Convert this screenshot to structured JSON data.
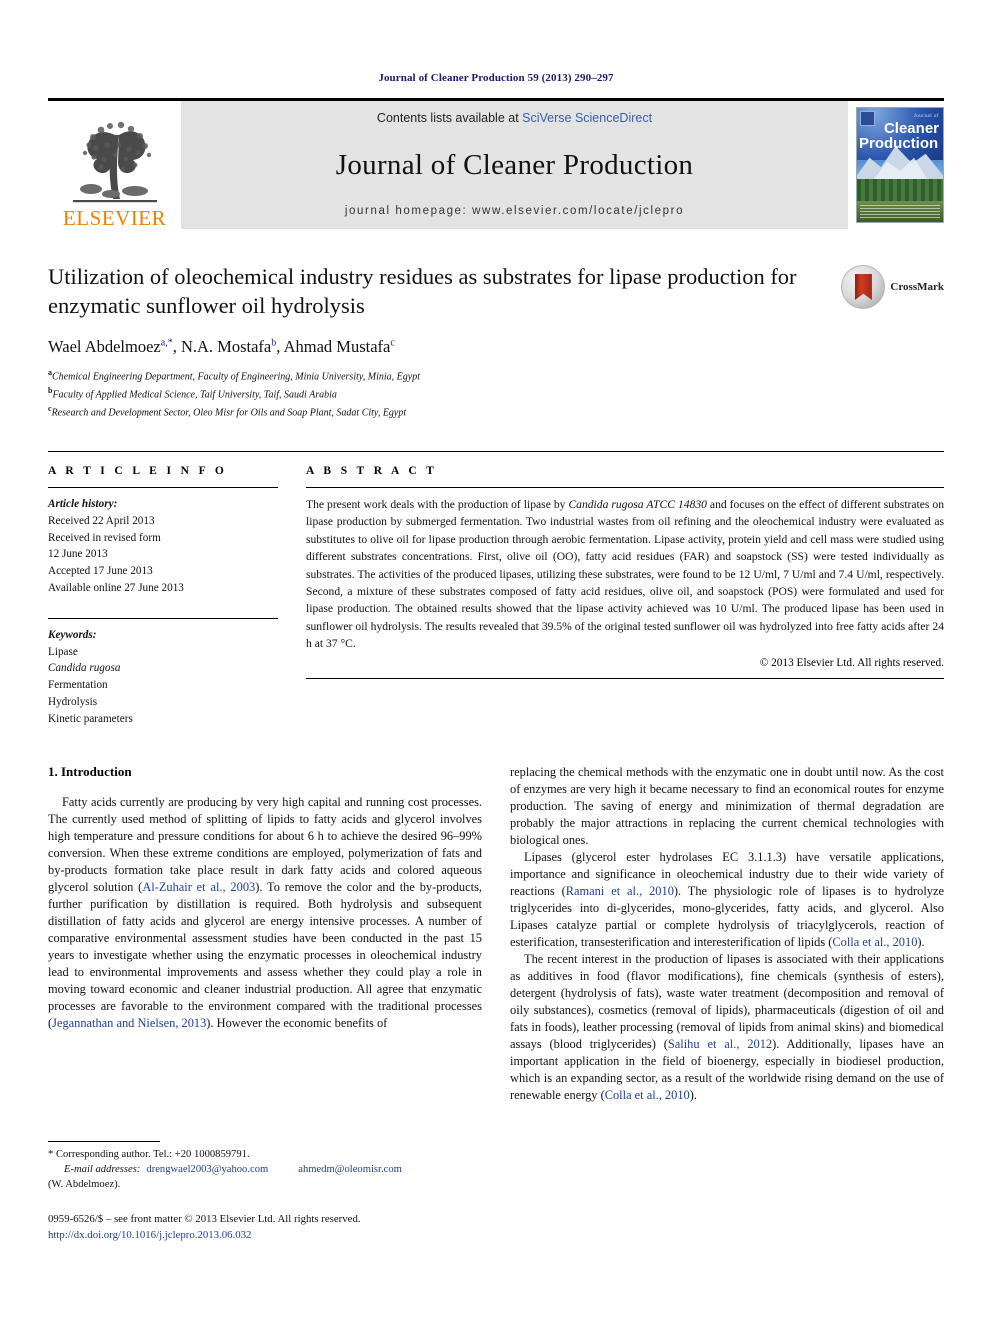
{
  "running_head": "Journal of Cleaner Production 59 (2013) 290–297",
  "masthead": {
    "contents_prefix": "Contents lists available at ",
    "sciencedirect": "SciVerse ScienceDirect",
    "journal_title": "Journal of Cleaner Production",
    "homepage": "journal homepage: www.elsevier.com/locate/jclepro",
    "publisher_wordmark": "ELSEVIER",
    "cover": {
      "journal_of": "Journal of",
      "line1": "Cleaner",
      "line2": "Production"
    }
  },
  "article": {
    "title": "Utilization of oleochemical industry residues as substrates for lipase production for enzymatic sunflower oil hydrolysis",
    "crossmark_label": "CrossMark",
    "authors_html": "Wael Abdelmoez<sup>a,*</sup>, N.A. Mostafa<sup>b</sup>, Ahmad Mustafa<sup>c</sup>",
    "affiliations": [
      {
        "marker": "a",
        "text": "Chemical Engineering Department, Faculty of Engineering, Minia University, Minia, Egypt"
      },
      {
        "marker": "b",
        "text": "Faculty of Applied Medical Science, Taif University, Taif, Saudi Arabia"
      },
      {
        "marker": "c",
        "text": "Research and Development Sector, Oleo Misr for Oils and Soap Plant, Sadat City, Egypt"
      }
    ]
  },
  "article_info": {
    "heading": "A R T I C L E   I N F O",
    "history_label": "Article history:",
    "history": [
      "Received 22 April 2013",
      "Received in revised form",
      "12 June 2013",
      "Accepted 17 June 2013",
      "Available online 27 June 2013"
    ],
    "keywords_label": "Keywords:",
    "keywords": [
      "Lipase",
      "Candida rugosa",
      "Fermentation",
      "Hydrolysis",
      "Kinetic parameters"
    ],
    "italic_keywords": [
      "Candida rugosa"
    ]
  },
  "abstract": {
    "heading": "A B S T R A C T",
    "text_html": "The present work deals with the production of lipase by <i>Candida rugosa ATCC 14830</i> and focuses on the effect of different substrates on lipase production by submerged fermentation. Two industrial wastes from oil refining and the oleochemical industry were evaluated as substitutes to olive oil for lipase production through aerobic fermentation. Lipase activity, protein yield and cell mass were studied using different substrates concentrations. First, olive oil (OO), fatty acid residues (FAR) and soapstock (SS) were tested individually as substrates. The activities of the produced lipases, utilizing these substrates, were found to be 12 U/ml, 7 U/ml and 7.4 U/ml, respectively. Second, a mixture of these substrates composed of fatty acid residues, olive oil, and soapstock (POS) were formulated and used for lipase production. The obtained results showed that the lipase activity achieved was 10 U/ml. The produced lipase has been used in sunflower oil hydrolysis. The results revealed that 39.5% of the original tested sunflower oil was hydrolyzed into free fatty acids after 24 h at 37 °C.",
    "copyright": "© 2013 Elsevier Ltd. All rights reserved."
  },
  "body": {
    "section_number_title": "1. Introduction",
    "left_paragraphs_html": [
      "Fatty acids currently are producing by very high capital and running cost processes. The currently used method of splitting of lipids to fatty acids and glycerol involves high temperature and pressure conditions for about 6 h to achieve the desired 96–99% conversion. When these extreme conditions are employed, polymerization of fats and by-products formation take place result in dark fatty acids and colored aqueous glycerol solution (<span class=\"cite\">Al-Zuhair et al., 2003</span>). To remove the color and the by-products, further purification by distillation is required. Both hydrolysis and subsequent distillation of fatty acids and glycerol are energy intensive processes. A number of comparative environmental assessment studies have been conducted in the past 15 years to investigate whether using the enzymatic processes in oleochemical industry lead to environmental improvements and assess whether they could play a role in moving toward economic and cleaner industrial production. All agree that enzymatic processes are favorable to the environment compared with the traditional processes (<span class=\"cite\">Jegannathan and Nielsen, 2013</span>). However the economic benefits of"
    ],
    "right_paragraphs_html": [
      "replacing the chemical methods with the enzymatic one in doubt until now. As the cost of enzymes are very high it became necessary to find an economical routes for enzyme production. The saving of energy and minimization of thermal degradation are probably the major attractions in replacing the current chemical technologies with biological ones.",
      "Lipases (glycerol ester hydrolases EC 3.1.1.3) have versatile applications, importance and significance in oleochemical industry due to their wide variety of reactions (<span class=\"cite\">Ramani et al., 2010</span>). The physiologic role of lipases is to hydrolyze triglycerides into di-glycerides, mono-glycerides, fatty acids, and glycerol. Also Lipases catalyze partial or complete hydrolysis of triacylglycerols, reaction of esterification, transesterification and interesterification of lipids (<span class=\"cite\">Colla et al., 2010</span>).",
      "The recent interest in the production of lipases is associated with their applications as additives in food (flavor modifications), fine chemicals (synthesis of esters), detergent (hydrolysis of fats), waste water treatment (decomposition and removal of oily substances), cosmetics (removal of lipids), pharmaceuticals (digestion of oil and fats in foods), leather processing (removal of lipids from animal skins) and biomedical assays (blood triglycerides) (<span class=\"cite\">Salihu et al., 2012</span>). Additionally, lipases have an important application in the field of bioenergy, especially in biodiesel production, which is an expanding sector, as a result of the worldwide rising demand on the use of renewable energy (<span class=\"cite\">Colla et al., 2010</span>)."
    ]
  },
  "footnote": {
    "corresponding": "* Corresponding author. Tel.: +20 1000859791.",
    "email_label": "E-mail addresses:",
    "email_1": "drengwael2003@yahoo.com",
    "email_2": "ahmedm@oleomisr.com",
    "email_owner": "(W. Abdelmoez)."
  },
  "footer": {
    "issn_line": "0959-6526/$ – see front matter © 2013 Elsevier Ltd. All rights reserved.",
    "doi": "http://dx.doi.org/10.1016/j.jclepro.2013.06.032"
  },
  "colors": {
    "link_blue": "#1f3f8f",
    "elsevier_orange": "#f08000",
    "masthead_grey": "#e3e3e3",
    "running_head_blue": "#1a1a6e"
  }
}
